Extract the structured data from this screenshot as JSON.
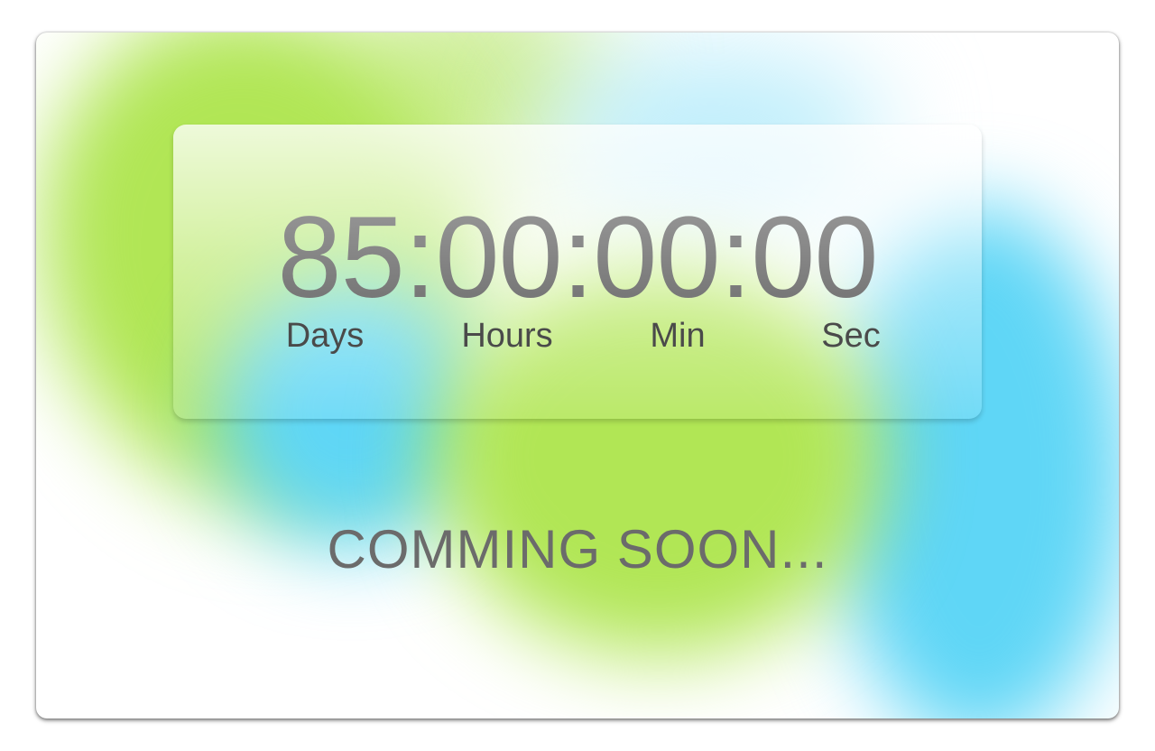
{
  "countdown": {
    "display": "85:00:00:00",
    "days": "85",
    "hours": "00",
    "minutes": "00",
    "seconds": "00",
    "labels": {
      "days": "Days",
      "hours": "Hours",
      "min": "Min",
      "sec": "Sec"
    }
  },
  "message": "COMMING SOON...",
  "colors": {
    "accent_green": "#b1e655",
    "accent_cyan": "#5fd6f6",
    "text_gray": "#6b6b6b"
  }
}
